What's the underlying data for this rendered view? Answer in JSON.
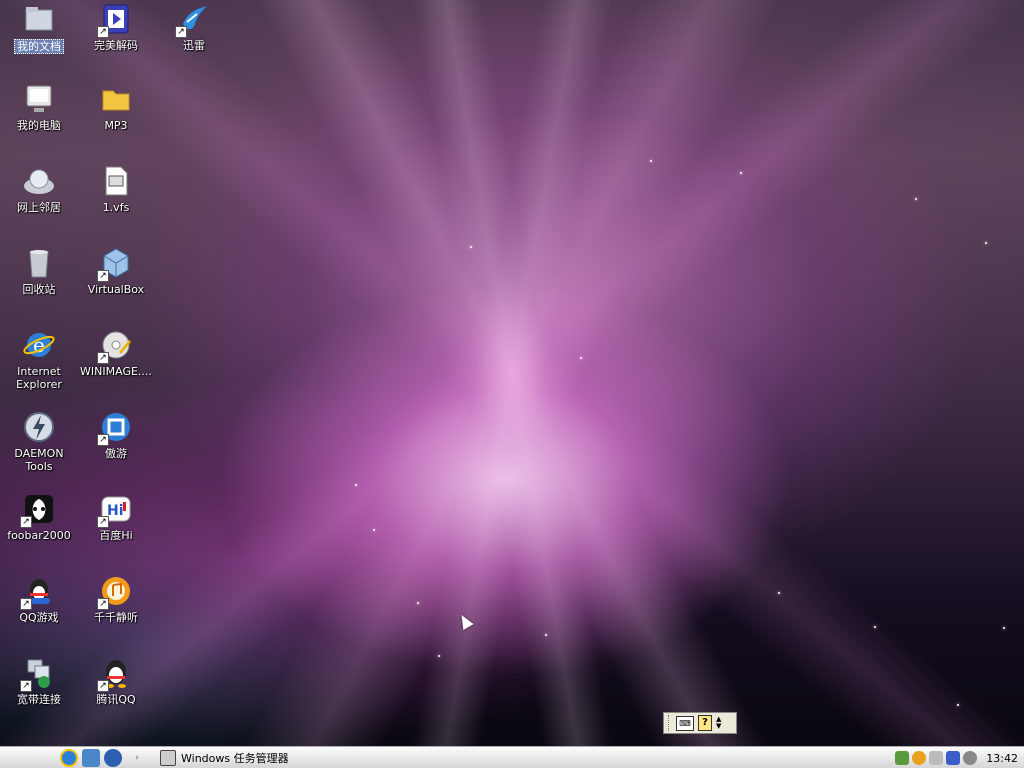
{
  "desktop": {
    "icons": [
      {
        "label": "我的文档"
      },
      {
        "label": "完美解码"
      },
      {
        "label": "迅雷"
      },
      {
        "label": "我的电脑"
      },
      {
        "label": "MP3"
      },
      {
        "label": "网上邻居"
      },
      {
        "label": "1.vfs"
      },
      {
        "label": "回收站"
      },
      {
        "label": "VirtualBox"
      },
      {
        "label": "Internet Explorer"
      },
      {
        "label": "WINIMAGE...."
      },
      {
        "label": "DAEMON Tools"
      },
      {
        "label": "傲游"
      },
      {
        "label": "foobar2000"
      },
      {
        "label": "百度Hi"
      },
      {
        "label": "QQ游戏"
      },
      {
        "label": "千千静听"
      },
      {
        "label": "宽带连接"
      },
      {
        "label": "腾讯QQ"
      }
    ]
  },
  "ime_bar": {
    "keyboard_icon": "keyboard-icon",
    "help_icon": "help-icon"
  },
  "taskbar": {
    "start_icon": "apple-icon",
    "quick_launch": [
      "ie-icon",
      "explorer-icon",
      "media-player-icon"
    ],
    "task": {
      "label": "Windows 任务管理器"
    },
    "clock": "13:42"
  }
}
